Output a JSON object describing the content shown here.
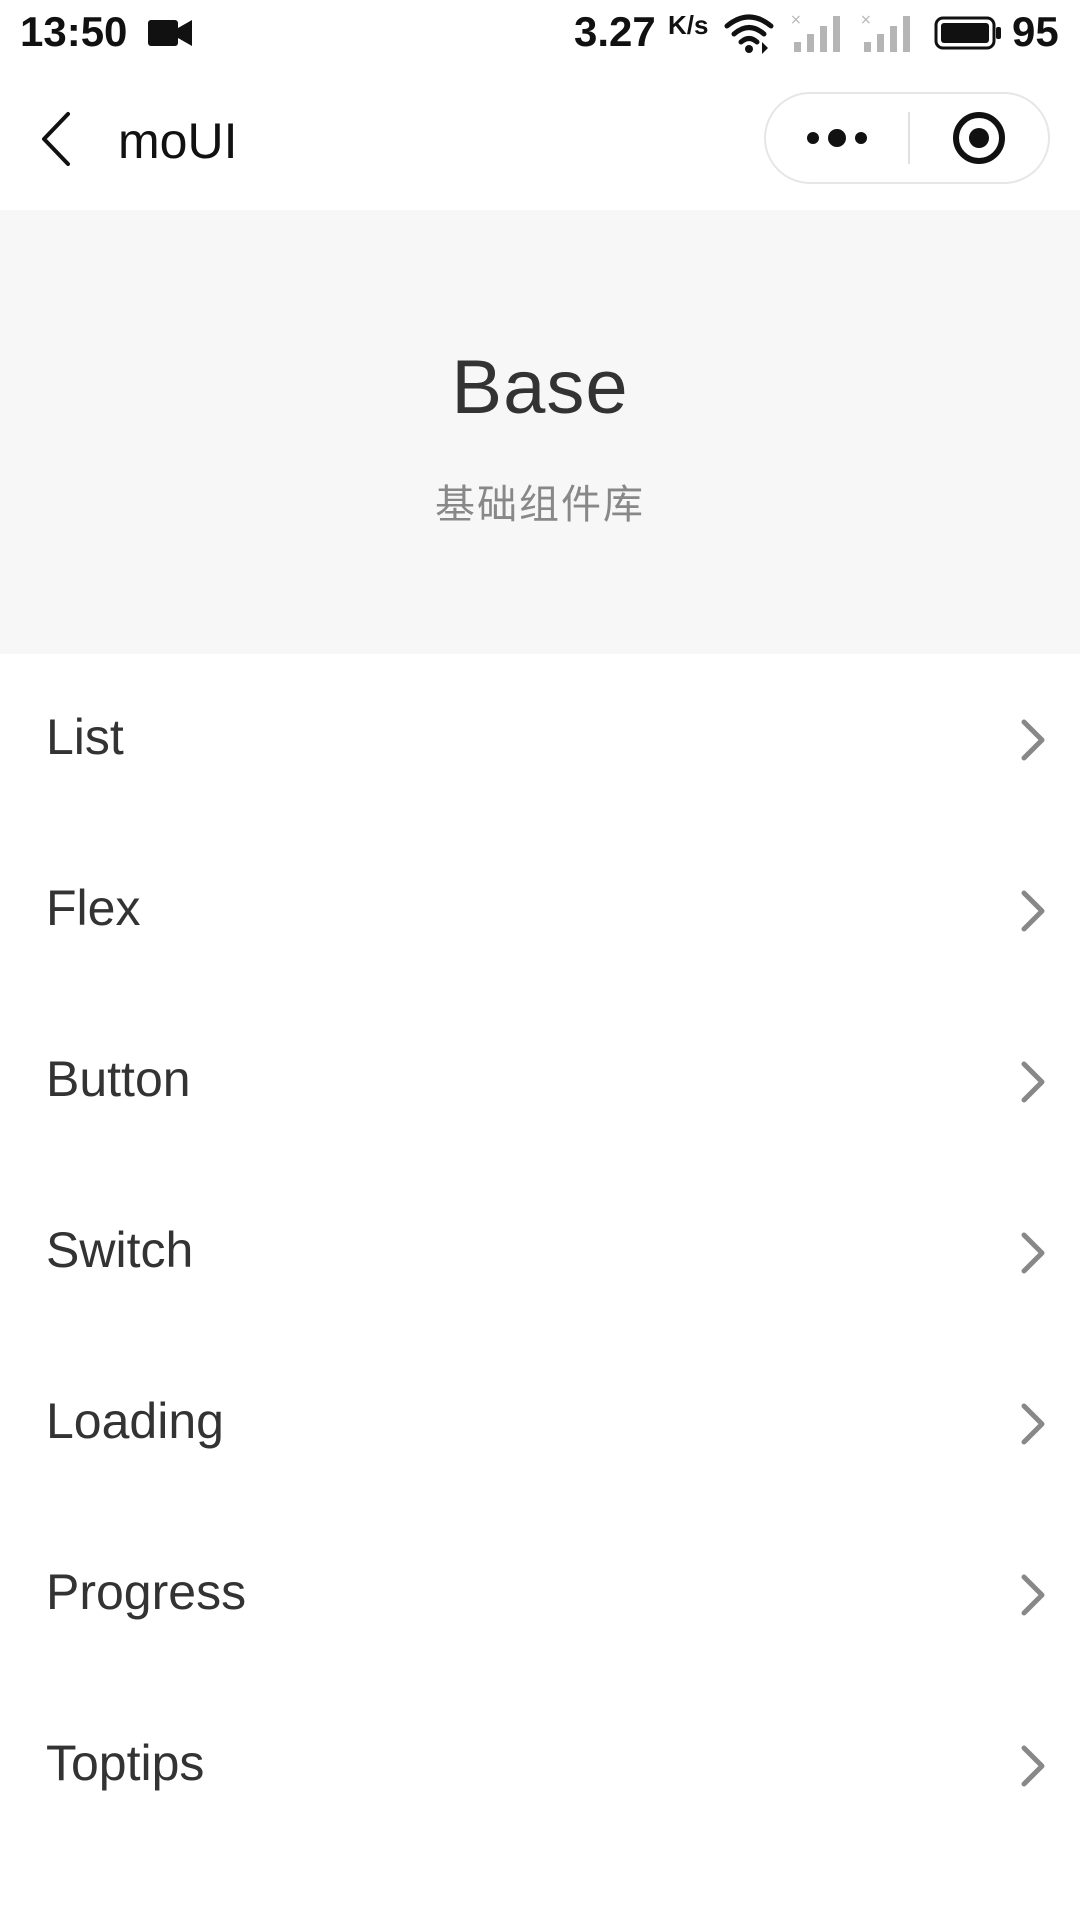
{
  "status_bar": {
    "time": "13:50",
    "camera_icon": "video-camera-icon",
    "network_speed": "3.27",
    "network_speed_unit": "K/s",
    "wifi_icon": "wifi-icon",
    "signal_icons": [
      "signal-off-icon",
      "signal-off-icon"
    ],
    "battery_icon": "battery-icon",
    "battery_level": "95"
  },
  "nav": {
    "back_icon": "chevron-left-icon",
    "title": "moUI",
    "more_icon": "more-dots-icon",
    "close_icon": "target-circle-icon"
  },
  "header": {
    "title": "Base",
    "subtitle": "基础组件库"
  },
  "list": {
    "items": [
      {
        "label": "List"
      },
      {
        "label": "Flex"
      },
      {
        "label": "Button"
      },
      {
        "label": "Switch"
      },
      {
        "label": "Loading"
      },
      {
        "label": "Progress"
      },
      {
        "label": "Toptips"
      }
    ],
    "chevron_icon": "chevron-right-icon"
  },
  "colors": {
    "header_bg": "#f7f7f7",
    "text_primary": "#333333",
    "text_secondary": "#888888",
    "chevron": "#888888"
  }
}
